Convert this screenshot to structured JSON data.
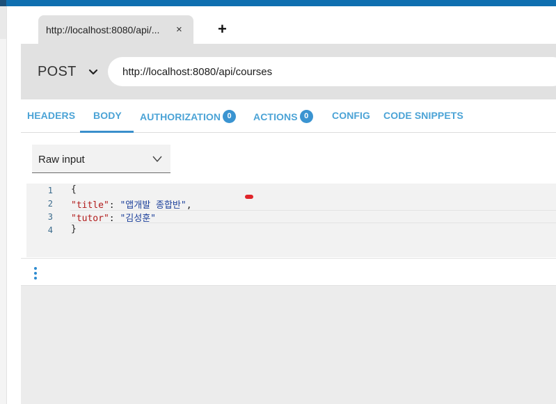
{
  "tab": {
    "title": "http://localhost:8080/api/...",
    "close": "×",
    "new_tab": "+"
  },
  "request": {
    "method": "POST",
    "url": "http://localhost:8080/api/courses"
  },
  "request_tabs": [
    {
      "label": "HEADERS"
    },
    {
      "label": "BODY",
      "active": true
    },
    {
      "label": "AUTHORIZATION",
      "badge": "0"
    },
    {
      "label": "ACTIONS",
      "badge": "0"
    },
    {
      "label": "CONFIG"
    },
    {
      "label": "CODE SNIPPETS"
    }
  ],
  "body": {
    "input_mode": "Raw input",
    "line_numbers": [
      "1",
      "2",
      "3",
      "4"
    ],
    "lines": {
      "l1": "{",
      "l2_key": "\"title\"",
      "l2_colon": ": ",
      "l2_value": "\"앱개발 종합반\"",
      "l2_comma": ",",
      "l3_key": "\"tutor\"",
      "l3_colon": ": ",
      "l3_value": "\"김성훈\"",
      "l4": "}"
    }
  },
  "icons": {
    "method_caret": "chevron-down-icon",
    "dropdown_chevron": "chevron-down-icon",
    "more": "more-vertical-icon"
  },
  "colors": {
    "accent": "#4ba3d6",
    "badge": "#3a94d1",
    "topbar": "#0f6fb0",
    "json_key": "#b11a1a",
    "json_string": "#1b3f9a"
  }
}
